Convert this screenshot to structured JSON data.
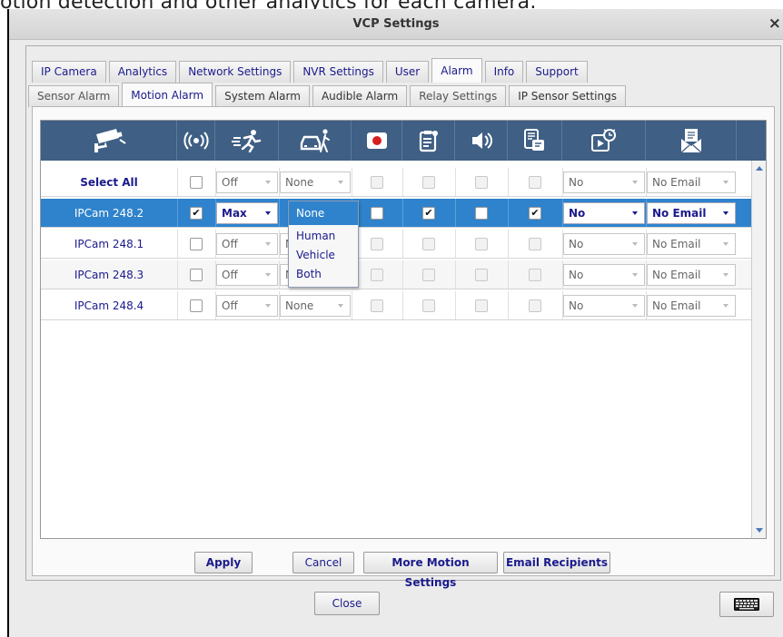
{
  "caption": "otion detection and other analytics for each camera.",
  "window": {
    "title": "VCP Settings",
    "close_glyph": "×"
  },
  "tabs": [
    "IP Camera",
    "Analytics",
    "Network Settings",
    "NVR Settings",
    "User",
    "Alarm",
    "Info",
    "Support"
  ],
  "active_tab": "Alarm",
  "subtabs": [
    "Sensor Alarm",
    "Motion Alarm",
    "System Alarm",
    "Audible Alarm",
    "Relay Settings",
    "IP Sensor Settings"
  ],
  "active_subtab": "Motion Alarm",
  "columns": [
    {
      "key": "camera",
      "icon": "security-camera-icon"
    },
    {
      "key": "motion",
      "icon": "motion-signal-icon"
    },
    {
      "key": "sensitivity",
      "icon": "running-person-icon"
    },
    {
      "key": "object_type",
      "icon": "car-and-person-icon"
    },
    {
      "key": "record",
      "icon": "record-camera-icon"
    },
    {
      "key": "event_log",
      "icon": "clipboard-icon"
    },
    {
      "key": "buzzer",
      "icon": "speaker-icon"
    },
    {
      "key": "push",
      "icon": "mobile-push-icon"
    },
    {
      "key": "snapshot",
      "icon": "alarm-clock-video-icon"
    },
    {
      "key": "email",
      "icon": "email-envelope-icon"
    }
  ],
  "rows": [
    {
      "name": "Select All",
      "enabled": false,
      "sensitivity": "Off",
      "object_type": "None",
      "record": false,
      "event_log": false,
      "buzzer": false,
      "push": false,
      "snapshot": "No",
      "email": "No Email"
    },
    {
      "name": "IPCam 248.2",
      "enabled": true,
      "sensitivity": "Max",
      "object_type": "None",
      "record": false,
      "event_log": true,
      "buzzer": false,
      "push": true,
      "snapshot": "No",
      "email": "No Email"
    },
    {
      "name": "IPCam 248.1",
      "enabled": false,
      "sensitivity": "Off",
      "object_type": "None",
      "record": false,
      "event_log": false,
      "buzzer": false,
      "push": false,
      "snapshot": "No",
      "email": "No Email"
    },
    {
      "name": "IPCam 248.3",
      "enabled": false,
      "sensitivity": "Off",
      "object_type": "None",
      "record": false,
      "event_log": false,
      "buzzer": false,
      "push": false,
      "snapshot": "No",
      "email": "No Email"
    },
    {
      "name": "IPCam 248.4",
      "enabled": false,
      "sensitivity": "Off",
      "object_type": "None",
      "record": false,
      "event_log": false,
      "buzzer": false,
      "push": false,
      "snapshot": "No",
      "email": "No Email"
    }
  ],
  "selected_row": 1,
  "dropdown": {
    "open_for_row": 1,
    "options": [
      "None",
      "Human",
      "Vehicle",
      "Both"
    ],
    "selected": "None"
  },
  "buttons": {
    "apply": "Apply",
    "cancel": "Cancel",
    "more": "More Motion Settings",
    "email": "Email Recipients",
    "close": "Close"
  },
  "keyboard_button": {
    "icon": "keyboard-icon"
  },
  "colors": {
    "header": "#3f5f84",
    "selected_row": "#2e83cc",
    "link_text": "#1a1a8c"
  }
}
